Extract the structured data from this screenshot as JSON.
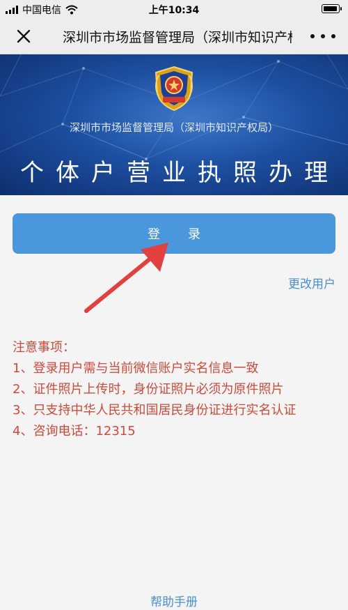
{
  "status_bar": {
    "carrier": "中国电信",
    "time": "上午10:34",
    "icons": [
      "signal-icon",
      "wifi-icon",
      "battery-icon"
    ]
  },
  "nav": {
    "title": "深圳市市场监督管理局（深圳市知识产权局）",
    "close_icon": "close-icon",
    "more_icon": "more-icon"
  },
  "banner": {
    "org_name": "深圳市市场监督管理局（深圳市知识产权局）",
    "title": "个体户营业执照办理",
    "emblem_text": "市场监督管理"
  },
  "login_button": "登录",
  "change_user": "更改用户",
  "notes": {
    "heading": "注意事项：",
    "items": [
      "1、登录用户需与当前微信账户实名信息一致",
      "2、证件照片上传时，身份证照片必须为原件照片",
      "3、只支持中华人民共和国居民身份证进行实名认证",
      "4、咨询电话：12315"
    ]
  },
  "help_link": "帮助手册",
  "colors": {
    "button": "#4b97dc",
    "link": "#4b8fcf",
    "notes": "#cf4a3b",
    "arrow": "#e2403f"
  }
}
